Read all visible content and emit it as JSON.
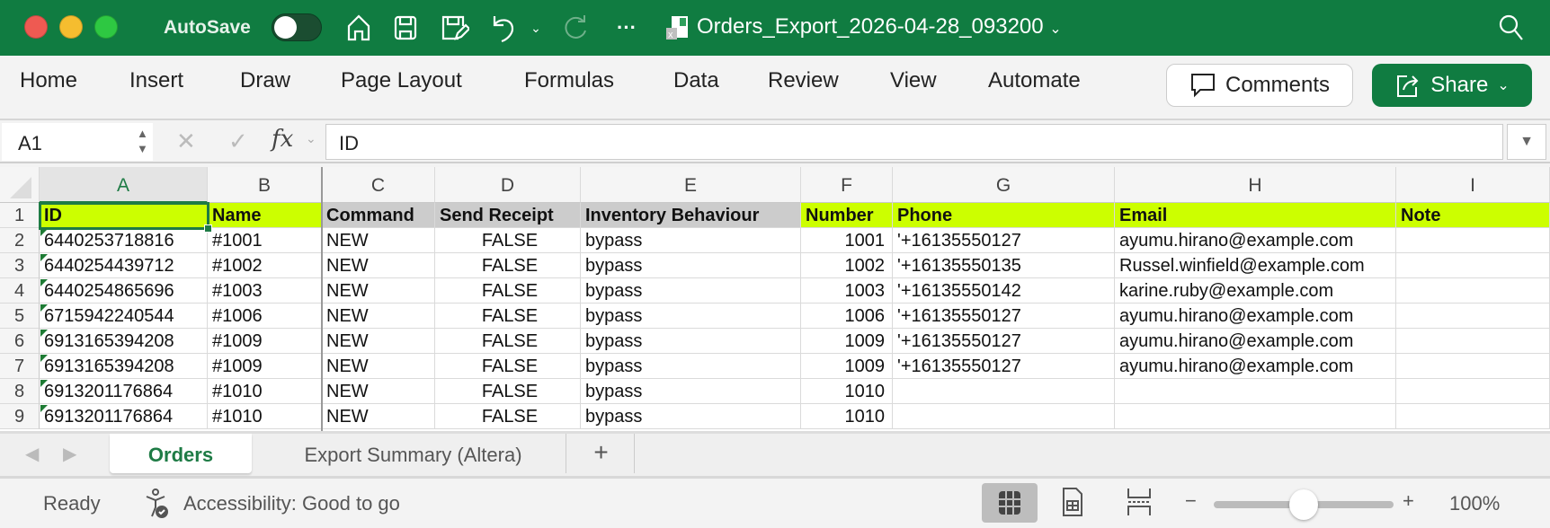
{
  "titlebar": {
    "autosave_label": "AutoSave",
    "autosave_on": false,
    "doc_title": "Orders_Export_2026-04-28_093200",
    "icons": [
      "home-icon",
      "save-icon",
      "save-as-icon",
      "undo-icon",
      "redo-icon",
      "more-icon",
      "search-icon"
    ]
  },
  "ribbon": {
    "tabs": [
      "Home",
      "Insert",
      "Draw",
      "Page Layout",
      "Formulas",
      "Data",
      "Review",
      "View",
      "Automate"
    ],
    "comments_label": "Comments",
    "share_label": "Share"
  },
  "formula_bar": {
    "name_box": "A1",
    "fx": "fx",
    "value": "ID"
  },
  "grid": {
    "columns": [
      "A",
      "B",
      "C",
      "D",
      "E",
      "F",
      "G",
      "H",
      "I"
    ],
    "row_numbers": [
      "1",
      "2",
      "3",
      "4",
      "5",
      "6",
      "7",
      "8",
      "9"
    ],
    "header": [
      "ID",
      "Name",
      "Command",
      "Send Receipt",
      "Inventory Behaviour",
      "Number",
      "Phone",
      "Email",
      "Note"
    ],
    "header_colors": {
      "highlight": "#ccff00",
      "gray": "#cccccc"
    },
    "rows": [
      [
        "6440253718816",
        "#1001",
        "NEW",
        "FALSE",
        "bypass",
        "1001",
        "'+16135550127",
        "ayumu.hirano@example.com",
        ""
      ],
      [
        "6440254439712",
        "#1002",
        "NEW",
        "FALSE",
        "bypass",
        "1002",
        "'+16135550135",
        "Russel.winfield@example.com",
        ""
      ],
      [
        "6440254865696",
        "#1003",
        "NEW",
        "FALSE",
        "bypass",
        "1003",
        "'+16135550142",
        "karine.ruby@example.com",
        ""
      ],
      [
        "6715942240544",
        "#1006",
        "NEW",
        "FALSE",
        "bypass",
        "1006",
        "'+16135550127",
        "ayumu.hirano@example.com",
        ""
      ],
      [
        "6913165394208",
        "#1009",
        "NEW",
        "FALSE",
        "bypass",
        "1009",
        "'+16135550127",
        "ayumu.hirano@example.com",
        ""
      ],
      [
        "6913165394208",
        "#1009",
        "NEW",
        "FALSE",
        "bypass",
        "1009",
        "'+16135550127",
        "ayumu.hirano@example.com",
        ""
      ],
      [
        "6913201176864",
        "#1010",
        "NEW",
        "FALSE",
        "bypass",
        "1010",
        "",
        "",
        " "
      ],
      [
        "6913201176864",
        "#1010",
        "NEW",
        "FALSE",
        "bypass",
        "1010",
        "",
        "",
        ""
      ]
    ]
  },
  "sheets": {
    "tabs": [
      "Orders",
      "Export Summary (Altera)"
    ],
    "active": "Orders",
    "add": "+"
  },
  "status": {
    "ready": "Ready",
    "accessibility": "Accessibility: Good to go",
    "zoom_minus": "−",
    "zoom_plus": "+",
    "zoom": "100%",
    "zoom_fraction": 0.5
  },
  "colors": {
    "brand": "#107c41"
  }
}
